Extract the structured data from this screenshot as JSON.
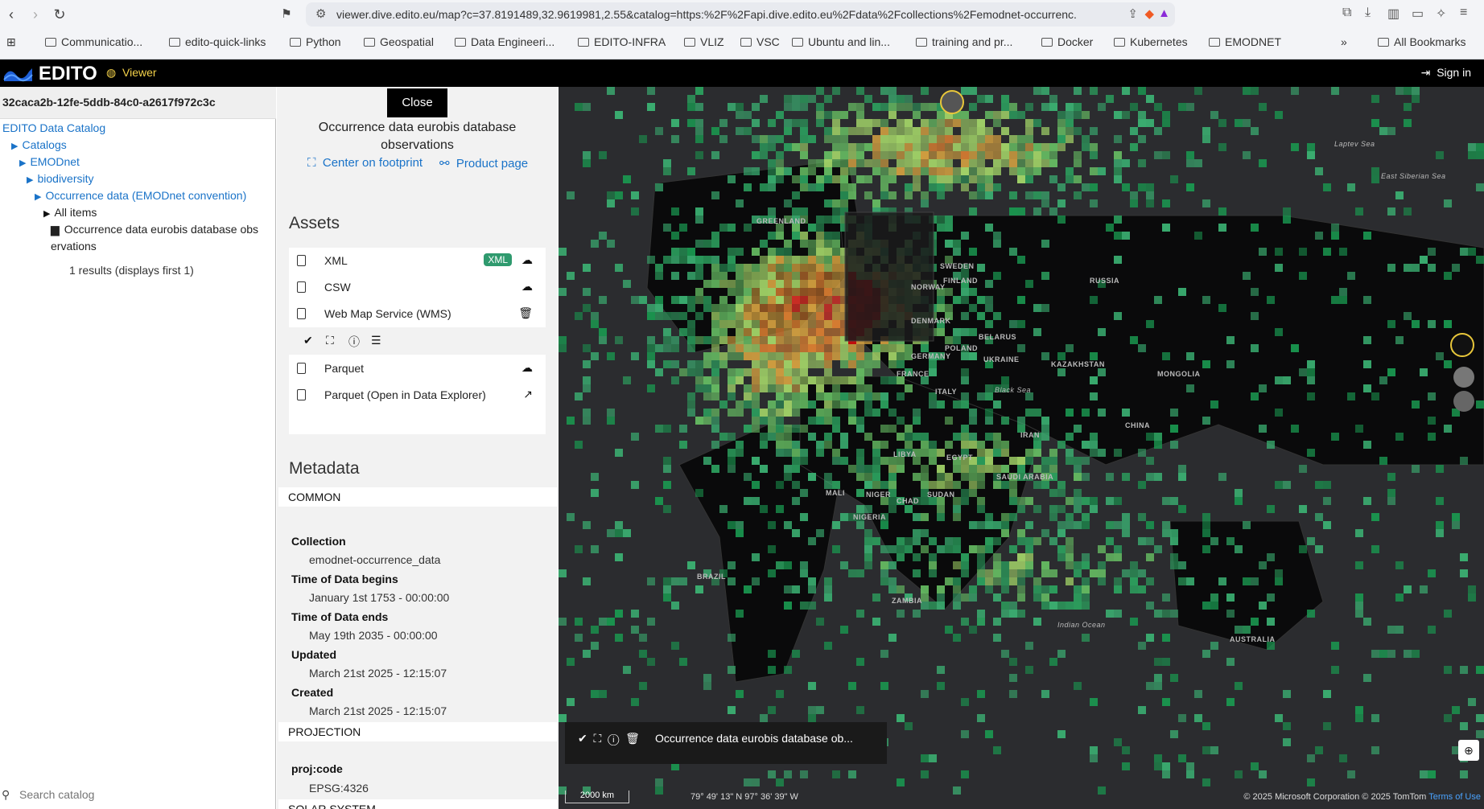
{
  "browser": {
    "url": "viewer.dive.edito.eu/map?c=37.8191489,32.9619981,2.55&catalog=https:%2F%2Fapi.dive.edito.eu%2Fdata%2Fcollections%2Femodnet-occurrenc...",
    "bookmarks": [
      "Communicatio...",
      "edito-quick-links",
      "Python",
      "Geospatial",
      "Data Engineeri...",
      "EDITO-INFRA",
      "VLIZ",
      "VSC",
      "Ubuntu and lin...",
      "training and pr...",
      "Docker",
      "Kubernetes",
      "EMODNET"
    ],
    "more_bookmarks": "»",
    "all_bookmarks": "All Bookmarks"
  },
  "app": {
    "logo_text": "EDITO",
    "viewer_label": "Viewer",
    "sign_in": "Sign in"
  },
  "catalog": {
    "item_id": "32caca2b-12fe-5ddb-84c0-a2617f972c3c",
    "root": "EDITO Data Catalog",
    "tree": [
      "Catalogs",
      "EMODnet",
      "biodiversity",
      "Occurrence data (EMODnet convention)"
    ],
    "all_items": "All items",
    "leaf_line1": "Occurrence data eurobis database obs",
    "leaf_line2": "ervations",
    "results": "1 results (displays first 1)",
    "search_placeholder": "Search catalog"
  },
  "details": {
    "close": "Close",
    "title_line1": "Occurrence data eurobis database",
    "title_line2": "observations",
    "center_on_footprint": "Center on footprint",
    "product_page": "Product page",
    "assets_heading": "Assets",
    "assets": [
      {
        "label": "XML",
        "badge": "XML",
        "icon": "cloud-download-icon"
      },
      {
        "label": "CSW",
        "icon": "cloud-download-icon"
      },
      {
        "label": "Web Map Service (WMS)",
        "icon": "trash-icon"
      },
      {
        "label": "Parquet",
        "icon": "cloud-download-icon"
      },
      {
        "label": "Parquet (Open in Data Explorer)",
        "icon": "external-link-icon"
      }
    ],
    "metadata_heading": "Metadata",
    "common_section": "COMMON",
    "collection_key": "Collection",
    "collection_val": "emodnet-occurrence_data",
    "begins_key": "Time of Data begins",
    "begins_val": "January 1st 1753 - 00:00:00",
    "ends_key": "Time of Data ends",
    "ends_val": "May 19th 2035 - 00:00:00",
    "updated_key": "Updated",
    "updated_val": "March 21st 2025 - 12:15:07",
    "created_key": "Created",
    "created_val": "March 21st 2025 - 12:15:07",
    "projection_section": "PROJECTION",
    "proj_key": "proj:code",
    "proj_val": "EPSG:4326",
    "solar_section": "SOLAR SYSTEM"
  },
  "map": {
    "legend_text": "Occurrence data eurobis database ob...",
    "scale": "2000 km",
    "coords": "79° 49' 13\" N 97° 36' 39\" W",
    "attribution": "© 2025 Microsoft Corporation © 2025 TomTom",
    "terms": "Terms of Use",
    "labels": [
      "GREENLAND",
      "SWEDEN",
      "FINLAND",
      "NORWAY",
      "RUSSIA",
      "DENMARK",
      "BELARUS",
      "POLAND",
      "GERMANY",
      "UKRAINE",
      "FRANCE",
      "ITALY",
      "KAZAKHSTAN",
      "MONGOLIA",
      "CHINA",
      "IRAN",
      "LIBYA",
      "EGYPT",
      "SAUDI ARABIA",
      "MALI",
      "NIGER",
      "CHAD",
      "SUDAN",
      "NIGERIA",
      "BRAZIL",
      "ZAMBIA",
      "AUSTRALIA",
      "Indian Ocean",
      "Black Sea",
      "East Siberian Sea",
      "Laptev Sea"
    ]
  }
}
